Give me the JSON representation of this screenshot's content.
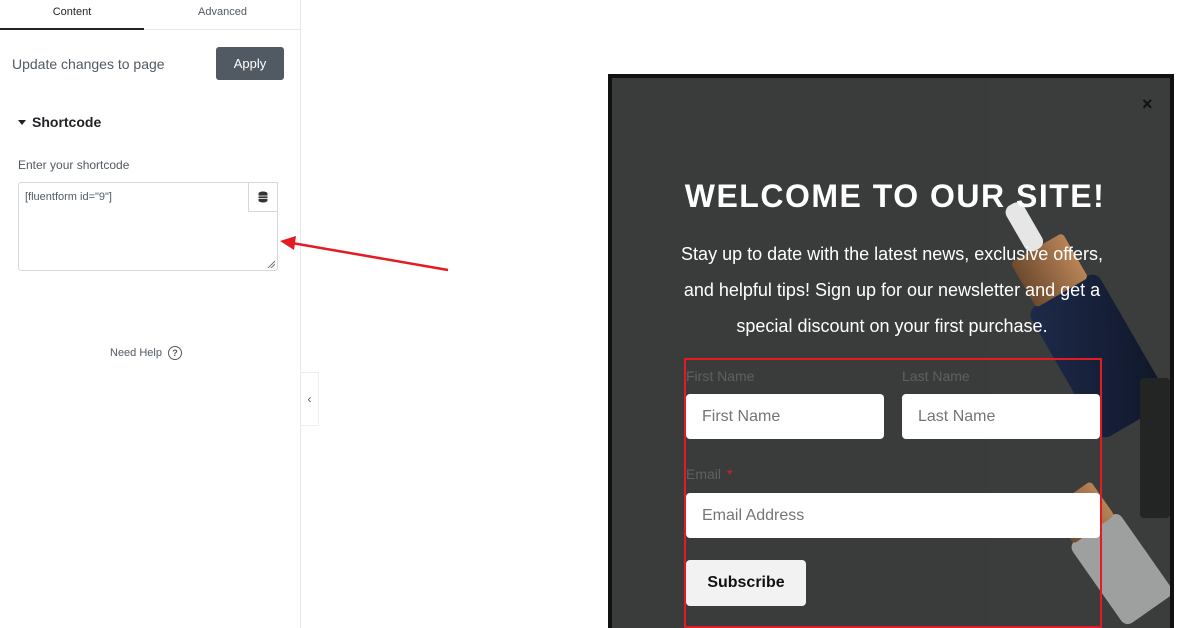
{
  "panel": {
    "tabs": [
      {
        "label": "Content"
      },
      {
        "label": "Advanced"
      }
    ],
    "update_text": "Update changes to page",
    "apply_label": "Apply",
    "section_title": "Shortcode",
    "shortcode_label": "Enter your shortcode",
    "shortcode_value": "[fluentform id=\"9\"]",
    "need_help": "Need Help",
    "help_glyph": "?",
    "collapse_glyph": "‹"
  },
  "popup": {
    "close_glyph": "×",
    "title": "WELCOME TO OUR SITE!",
    "intro": "Stay up to date with the latest news, exclusive offers, and helpful tips! Sign up for our newsletter and get a special discount on your first purchase.",
    "first_name_label": "First Name",
    "first_name_placeholder": "First Name",
    "last_name_label": "Last Name",
    "last_name_placeholder": "Last Name",
    "email_label": "Email",
    "email_required": "*",
    "email_placeholder": "Email Address",
    "subscribe_label": "Subscribe"
  },
  "colors": {
    "popup_bg": "#393c3b",
    "highlight_red": "#e41b23",
    "apply_bg": "#515962"
  },
  "icons": {
    "database": "database-icon",
    "help": "help-circle-icon",
    "collapse": "chevron-left-icon",
    "close": "close-icon",
    "caret": "caret-down-icon",
    "arrow": "annotation-arrow-icon"
  }
}
